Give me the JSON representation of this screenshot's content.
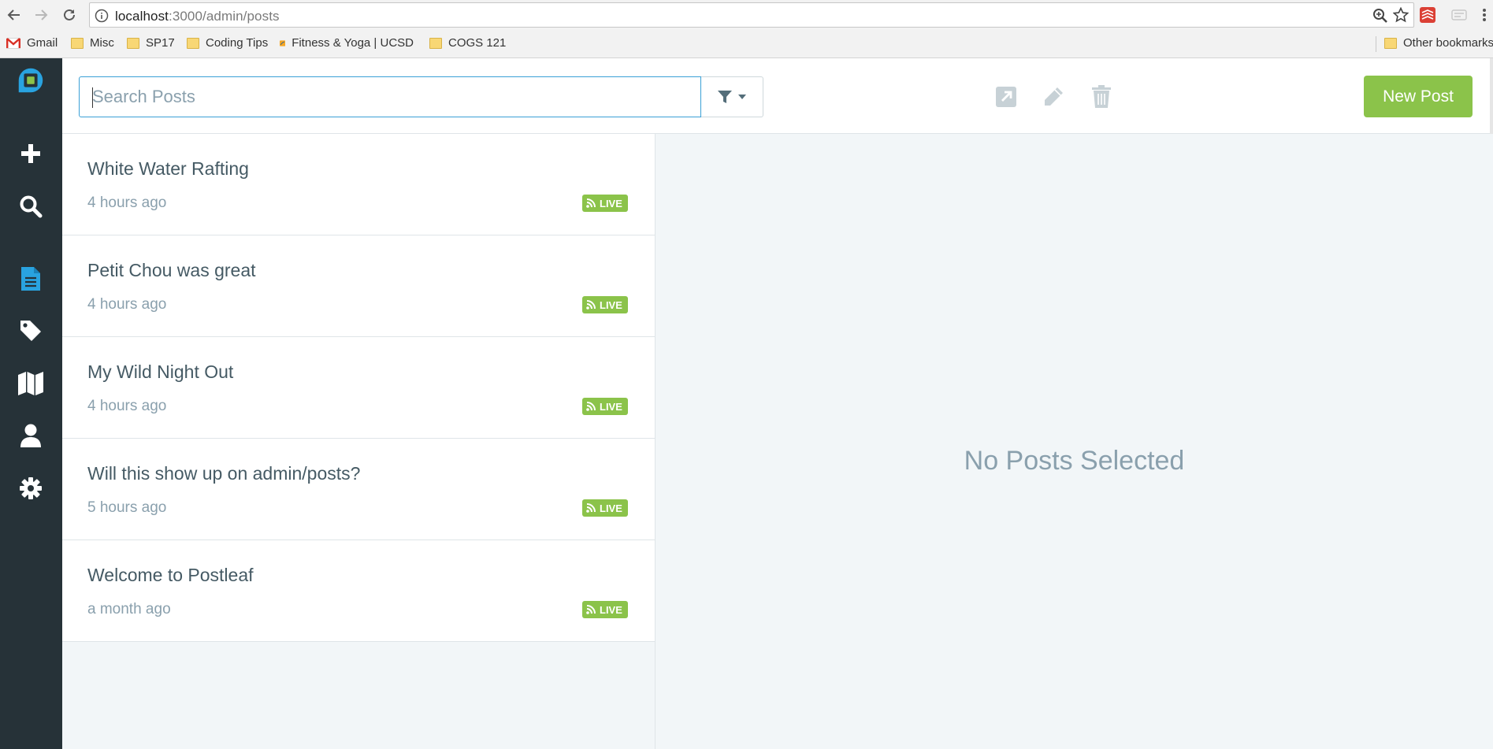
{
  "browser": {
    "url_host": "localhost",
    "url_path": ":3000/admin/posts",
    "bookmarks": [
      {
        "label": "Gmail"
      },
      {
        "label": "Misc"
      },
      {
        "label": "SP17"
      },
      {
        "label": "Coding Tips"
      },
      {
        "label": "Fitness & Yoga | UCSD"
      },
      {
        "label": "COGS 121"
      }
    ],
    "other_bookmarks": "Other bookmarks"
  },
  "sidebar": {
    "items": [
      {
        "icon": "plus-icon"
      },
      {
        "icon": "search-icon"
      },
      {
        "icon": "posts-icon",
        "active": true
      },
      {
        "icon": "tag-icon"
      },
      {
        "icon": "map-icon"
      },
      {
        "icon": "user-icon"
      },
      {
        "icon": "settings-icon"
      }
    ],
    "active_color": "#29a3e0",
    "color": "#ffffff"
  },
  "toolbar": {
    "search_placeholder": "Search Posts",
    "new_post_label": "New Post"
  },
  "posts": [
    {
      "title": "White Water Rafting",
      "time": "4 hours ago",
      "status": "LIVE"
    },
    {
      "title": "Petit Chou was great",
      "time": "4 hours ago",
      "status": "LIVE"
    },
    {
      "title": "My Wild Night Out",
      "time": "4 hours ago",
      "status": "LIVE"
    },
    {
      "title": "Will this show up on admin/posts?",
      "time": "5 hours ago",
      "status": "LIVE"
    },
    {
      "title": "Welcome to Postleaf",
      "time": "a month ago",
      "status": "LIVE"
    }
  ],
  "detail": {
    "empty_message": "No Posts Selected"
  },
  "colors": {
    "sidebar_bg": "#263238",
    "accent": "#8bc34a",
    "search_border": "#3aa0d6"
  }
}
